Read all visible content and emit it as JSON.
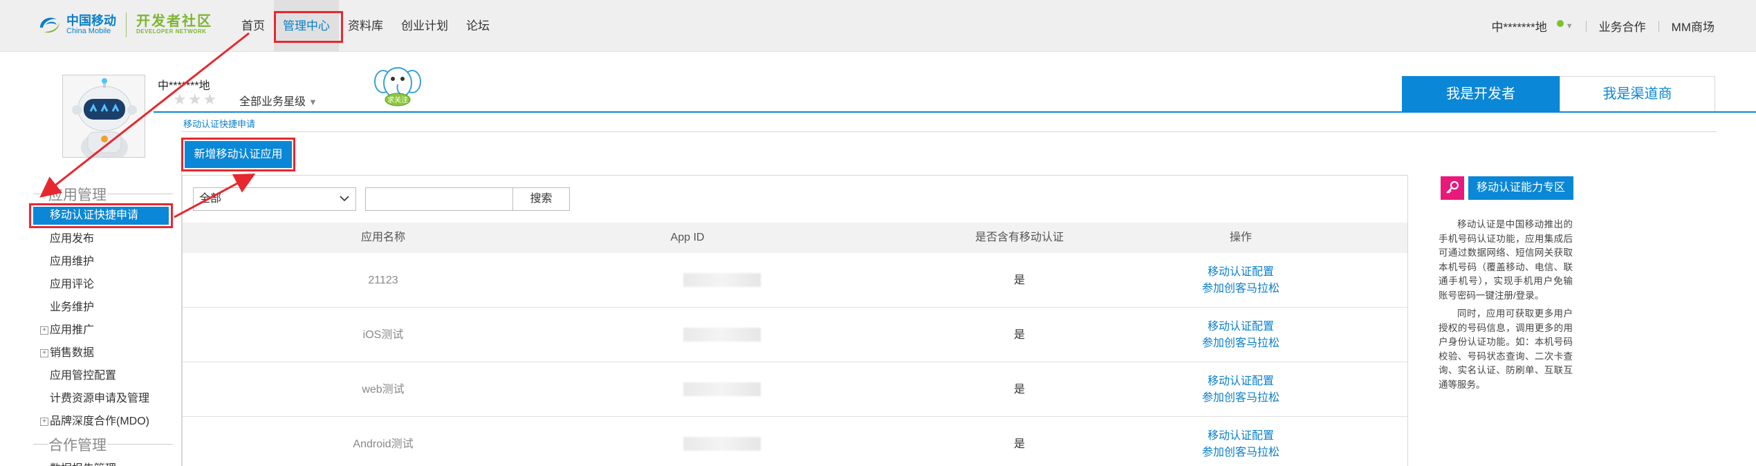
{
  "logo": {
    "cn": "中国移动",
    "en": "China Mobile",
    "dev_cn": "开发者社区",
    "dev_en": "DEVELOPER NETWORK"
  },
  "topnav": [
    {
      "label": "首页"
    },
    {
      "label": "管理中心",
      "active": true
    },
    {
      "label": "资料库"
    },
    {
      "label": "创业计划"
    },
    {
      "label": "论坛"
    }
  ],
  "topright": {
    "user": "中*******地",
    "links": [
      "业务合作",
      "MM商场"
    ]
  },
  "profile": {
    "username": "中*******地",
    "stars": "★★★",
    "star_label": "全部业务星级",
    "mascot_text": "求关注"
  },
  "role_tabs": {
    "developer": "我是开发者",
    "channel": "我是渠道商"
  },
  "breadcrumb": "移动认证快捷申请",
  "add_button": "新增移动认证应用",
  "sidebar": {
    "section1": "应用管理",
    "active_item": "移动认证快捷申请",
    "items": [
      {
        "label": "应用发布",
        "expand": false
      },
      {
        "label": "应用维护",
        "expand": false
      },
      {
        "label": "应用评论",
        "expand": false
      },
      {
        "label": "业务维护",
        "expand": false
      },
      {
        "label": "应用推广",
        "expand": true
      },
      {
        "label": "销售数据",
        "expand": true
      },
      {
        "label": "应用管控配置",
        "expand": false
      },
      {
        "label": "计费资源申请及管理",
        "expand": false
      },
      {
        "label": "品牌深度合作(MDO)",
        "expand": true
      }
    ],
    "section2": "合作管理",
    "cut_item": "数据报告管理"
  },
  "filter": {
    "select_value": "全部",
    "search_placeholder": "",
    "search_button": "搜索"
  },
  "table": {
    "headers": [
      "应用名称",
      "App ID",
      "是否含有移动认证",
      "操作"
    ],
    "rows": [
      {
        "name": "21123",
        "has_auth": "是",
        "op1": "移动认证配置",
        "op2": "参加创客马拉松"
      },
      {
        "name": "iOS测试",
        "has_auth": "是",
        "op1": "移动认证配置",
        "op2": "参加创客马拉松"
      },
      {
        "name": "web测试",
        "has_auth": "是",
        "op1": "移动认证配置",
        "op2": "参加创客马拉松"
      },
      {
        "name": "Android测试",
        "has_auth": "是",
        "op1": "移动认证配置",
        "op2": "参加创客马拉松"
      }
    ]
  },
  "right_panel": {
    "zone_button": "移动认证能力专区",
    "p1": "移动认证是中国移动推出的手机号码认证功能，应用集成后可通过数据网络、短信网关获取本机号码（覆盖移动、电信、联通手机号），实现手机用户免输账号密码一键注册/登录。",
    "p2": "同时，应用可获取更多用户授权的号码信息，调用更多的用户身份认证功能。如：本机号码校验、号码状态查询、二次卡查询、实名认证、防刷单、互联互通等服务。"
  },
  "colors": {
    "brand_blue": "#0a87d6",
    "highlight_red": "#e6282e",
    "logo_green": "#7cb530",
    "zone_pink": "#e8197a"
  }
}
